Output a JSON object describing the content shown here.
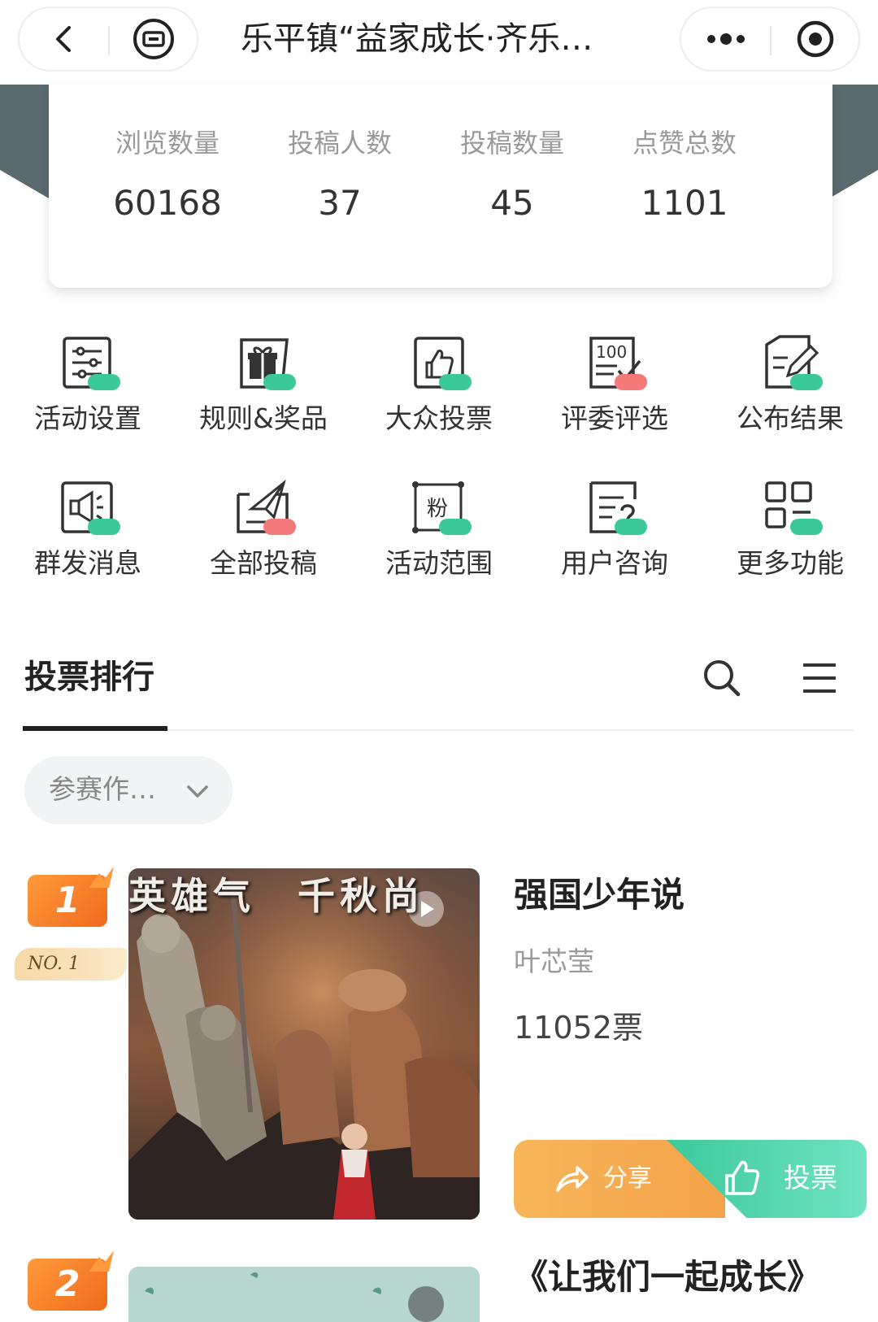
{
  "nav": {
    "title": "乐平镇“益家成长·齐乐…",
    "back_icon": "chevron-left-icon",
    "toggle_icon": "media-card-icon",
    "more_icon": "more-dots-icon",
    "close_icon": "target-circle-icon"
  },
  "stats": [
    {
      "label": "浏览数量",
      "value": "60168"
    },
    {
      "label": "投稿人数",
      "value": "37"
    },
    {
      "label": "投稿数量",
      "value": "45"
    },
    {
      "label": "点赞总数",
      "value": "1101"
    }
  ],
  "functions": [
    {
      "label": "活动设置",
      "icon": "settings-list-icon",
      "dot": "#3cc99a"
    },
    {
      "label": "规则&奖品",
      "icon": "gift-icon",
      "dot": "#3cc99a"
    },
    {
      "label": "大众投票",
      "icon": "thumbs-up-icon",
      "dot": "#3cc99a"
    },
    {
      "label": "评委评选",
      "icon": "score-check-icon",
      "dot": "#f47a7a"
    },
    {
      "label": "公布结果",
      "icon": "edit-document-icon",
      "dot": "#3cc99a"
    },
    {
      "label": "群发消息",
      "icon": "megaphone-icon",
      "dot": "#3cc99a"
    },
    {
      "label": "全部投稿",
      "icon": "paper-plane-tray-icon",
      "dot": "#f47a7a"
    },
    {
      "label": "活动范围",
      "icon": "fans-range-icon",
      "dot": "#3cc99a"
    },
    {
      "label": "用户咨询",
      "icon": "question-document-icon",
      "dot": "#3cc99a"
    },
    {
      "label": "更多功能",
      "icon": "grid-apps-icon",
      "dot": "#3cc99a"
    }
  ],
  "ranking": {
    "title": "投票排行",
    "filter_label": "参赛作…",
    "search_icon": "search-icon",
    "menu_icon": "menu-icon"
  },
  "entries": [
    {
      "rank": "1",
      "ribbon": "NO. 1",
      "title": "强国少年说",
      "author": "叶芯莹",
      "votes": "11052票",
      "share_label": "分享",
      "vote_label": "投票",
      "thumb_caption": "英雄气　千秋尚"
    },
    {
      "rank": "2",
      "title": "《让我们一起成长》"
    }
  ],
  "colors": {
    "accent_green": "#3cc99a",
    "accent_orange": "#f5a24a",
    "badge_orange": "#f06a1e",
    "banner_gray": "#5a6a6e"
  }
}
